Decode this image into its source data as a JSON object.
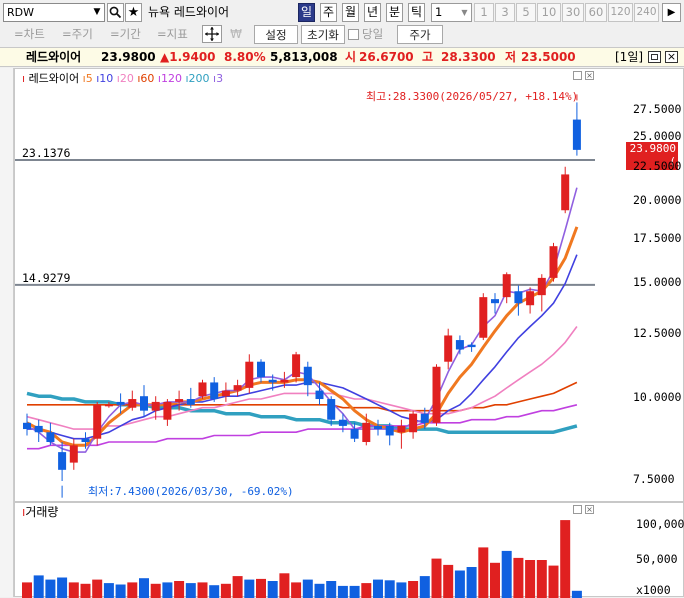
{
  "toolbar": {
    "symbol_input": "RDW",
    "search_icon": "search-icon",
    "star_icon": "star-icon",
    "stock_name": "뉴욕 레드와이어",
    "period_buttons": [
      "일",
      "주",
      "월",
      "년",
      "분",
      "틱"
    ],
    "active_period": "일",
    "interval_value": "1",
    "interval_options": [
      "1",
      "3",
      "5",
      "10",
      "30",
      "60",
      "120",
      "240"
    ],
    "arrow_icon": "arrow-right-icon"
  },
  "toolbar2": {
    "chart_btn": "=차트",
    "period_btn": "=주기",
    "range_btn": "=기간",
    "indicator_btn": "=지표",
    "move_icon": "crosshair-move-icon",
    "won_icon": "won-icon",
    "settings_btn": "설정",
    "reset_btn": "초기화",
    "today_label": "당일",
    "price_btn": "주가"
  },
  "quote": {
    "name": "레드와이어",
    "price": "23.9800",
    "change": "▲1.9400",
    "change_pct": "8.80%",
    "volume": "5,813,008",
    "open_label": "시",
    "open": "26.6700",
    "high_label": "고",
    "high": "28.3300",
    "low_label": "저",
    "low": "23.5000",
    "period_label": "[1일]",
    "colors": {
      "up": "#e02020",
      "down": "#1060e0",
      "high": "#e02020",
      "low": "#1060e0"
    }
  },
  "legend": {
    "title": "레드와이어",
    "items": [
      {
        "label": "5",
        "color": "#f07820"
      },
      {
        "label": "10",
        "color": "#4040e0"
      },
      {
        "label": "20",
        "color": "#f080c0"
      },
      {
        "label": "60",
        "color": "#e04000"
      },
      {
        "label": "120",
        "color": "#c040e0"
      },
      {
        "label": "200",
        "color": "#30a0c0"
      },
      {
        "label": "3",
        "color": "#9060e0"
      }
    ]
  },
  "annotations": {
    "max_label": "최고:28.3300(2026/05/27, +18.14%)",
    "min_label": "최저:7.4300(2026/03/30, -69.02%)",
    "line1_value": "23.1376",
    "line2_value": "14.9279",
    "current_price": "23.9800",
    "current_pct": "( 8.80%)"
  },
  "chart_data": [
    {
      "type": "candlestick",
      "title": "레드와이어",
      "yticks": [
        "27.5000",
        "25.0000",
        "22.5000",
        "20.0000",
        "17.5000",
        "15.0000",
        "12.5000",
        "10.0000",
        "7.5000"
      ],
      "ylim": [
        7.0,
        29.0
      ],
      "candles": [
        {
          "o": 9.2,
          "h": 9.5,
          "l": 8.8,
          "c": 9.0
        },
        {
          "o": 9.1,
          "h": 9.3,
          "l": 8.6,
          "c": 8.9
        },
        {
          "o": 8.9,
          "h": 9.2,
          "l": 8.5,
          "c": 8.6
        },
        {
          "o": 8.3,
          "h": 8.6,
          "l": 7.5,
          "c": 7.8
        },
        {
          "o": 8.0,
          "h": 8.7,
          "l": 7.8,
          "c": 8.5
        },
        {
          "o": 8.7,
          "h": 8.9,
          "l": 8.4,
          "c": 8.6
        },
        {
          "o": 8.7,
          "h": 9.9,
          "l": 8.5,
          "c": 9.8
        },
        {
          "o": 9.8,
          "h": 9.9,
          "l": 9.7,
          "c": 9.8
        },
        {
          "o": 9.9,
          "h": 10.2,
          "l": 9.5,
          "c": 9.8
        },
        {
          "o": 9.7,
          "h": 10.3,
          "l": 9.6,
          "c": 10.0
        },
        {
          "o": 10.1,
          "h": 10.5,
          "l": 9.4,
          "c": 9.6
        },
        {
          "o": 9.6,
          "h": 10.1,
          "l": 9.3,
          "c": 9.9
        },
        {
          "o": 9.3,
          "h": 10.0,
          "l": 9.1,
          "c": 9.9
        },
        {
          "o": 9.9,
          "h": 10.3,
          "l": 9.6,
          "c": 10.0
        },
        {
          "o": 10.0,
          "h": 10.4,
          "l": 9.7,
          "c": 9.8
        },
        {
          "o": 10.1,
          "h": 10.7,
          "l": 10.0,
          "c": 10.6
        },
        {
          "o": 10.6,
          "h": 10.8,
          "l": 9.9,
          "c": 10.0
        },
        {
          "o": 10.1,
          "h": 10.6,
          "l": 9.9,
          "c": 10.3
        },
        {
          "o": 10.3,
          "h": 10.7,
          "l": 10.1,
          "c": 10.5
        },
        {
          "o": 10.4,
          "h": 11.7,
          "l": 10.2,
          "c": 11.4
        },
        {
          "o": 11.4,
          "h": 11.5,
          "l": 10.6,
          "c": 10.8
        },
        {
          "o": 10.7,
          "h": 10.9,
          "l": 10.3,
          "c": 10.6
        },
        {
          "o": 10.6,
          "h": 11.0,
          "l": 10.4,
          "c": 10.7
        },
        {
          "o": 10.8,
          "h": 11.8,
          "l": 10.6,
          "c": 11.7
        },
        {
          "o": 11.2,
          "h": 11.4,
          "l": 10.1,
          "c": 10.5
        },
        {
          "o": 10.3,
          "h": 10.6,
          "l": 9.8,
          "c": 10.0
        },
        {
          "o": 10.0,
          "h": 10.1,
          "l": 9.1,
          "c": 9.3
        },
        {
          "o": 9.3,
          "h": 9.5,
          "l": 8.9,
          "c": 9.1
        },
        {
          "o": 9.0,
          "h": 9.2,
          "l": 8.6,
          "c": 8.7
        },
        {
          "o": 8.6,
          "h": 9.5,
          "l": 8.5,
          "c": 9.2
        },
        {
          "o": 9.1,
          "h": 9.3,
          "l": 8.8,
          "c": 9.0
        },
        {
          "o": 9.1,
          "h": 9.2,
          "l": 8.5,
          "c": 8.8
        },
        {
          "o": 8.9,
          "h": 9.3,
          "l": 8.4,
          "c": 9.1
        },
        {
          "o": 8.9,
          "h": 9.6,
          "l": 8.7,
          "c": 9.5
        },
        {
          "o": 9.5,
          "h": 9.7,
          "l": 9.0,
          "c": 9.2
        },
        {
          "o": 9.2,
          "h": 11.3,
          "l": 9.1,
          "c": 11.2
        },
        {
          "o": 11.4,
          "h": 12.8,
          "l": 11.1,
          "c": 12.5
        },
        {
          "o": 12.3,
          "h": 12.5,
          "l": 11.7,
          "c": 11.9
        },
        {
          "o": 12.1,
          "h": 12.2,
          "l": 11.8,
          "c": 12.0
        },
        {
          "o": 12.4,
          "h": 14.5,
          "l": 12.3,
          "c": 14.3
        },
        {
          "o": 14.2,
          "h": 14.5,
          "l": 13.5,
          "c": 14.0
        },
        {
          "o": 14.3,
          "h": 15.6,
          "l": 14.0,
          "c": 15.5
        },
        {
          "o": 14.6,
          "h": 14.9,
          "l": 13.4,
          "c": 14.0
        },
        {
          "o": 13.9,
          "h": 14.8,
          "l": 13.5,
          "c": 14.6
        },
        {
          "o": 14.4,
          "h": 15.5,
          "l": 13.6,
          "c": 15.3
        },
        {
          "o": 15.3,
          "h": 17.3,
          "l": 15.1,
          "c": 17.1
        },
        {
          "o": 19.4,
          "h": 22.6,
          "l": 19.2,
          "c": 22.0
        },
        {
          "o": 26.67,
          "h": 28.33,
          "l": 23.5,
          "c": 23.98
        }
      ],
      "series": [
        {
          "name": "5",
          "color": "#f07820",
          "values": [
            9.2,
            9.0,
            8.9,
            8.6,
            8.5,
            8.5,
            8.8,
            9.2,
            9.5,
            9.8,
            9.8,
            9.8,
            9.8,
            9.9,
            9.9,
            10.0,
            10.1,
            10.2,
            10.3,
            10.5,
            10.6,
            10.6,
            10.6,
            10.7,
            10.7,
            10.6,
            10.3,
            10.0,
            9.6,
            9.3,
            9.1,
            9.0,
            8.9,
            9.0,
            9.1,
            9.5,
            10.2,
            10.8,
            11.3,
            12.0,
            12.7,
            13.4,
            14.0,
            14.3,
            14.6,
            15.3,
            16.4,
            18.3
          ]
        },
        {
          "name": "10",
          "color": "#4040e0",
          "values": [
            9.0,
            9.0,
            8.9,
            8.8,
            8.7,
            8.7,
            8.8,
            8.9,
            9.1,
            9.3,
            9.4,
            9.6,
            9.7,
            9.8,
            9.9,
            9.9,
            10.0,
            10.1,
            10.1,
            10.2,
            10.3,
            10.4,
            10.5,
            10.5,
            10.6,
            10.6,
            10.5,
            10.4,
            10.2,
            10.0,
            9.8,
            9.6,
            9.4,
            9.3,
            9.2,
            9.3,
            9.6,
            9.8,
            10.2,
            10.7,
            11.2,
            11.8,
            12.4,
            12.9,
            13.4,
            14.0,
            15.0,
            16.6
          ]
        },
        {
          "name": "20",
          "color": "#f080c0",
          "values": [
            9.4,
            9.3,
            9.2,
            9.1,
            9.0,
            9.0,
            9.0,
            9.1,
            9.1,
            9.2,
            9.3,
            9.4,
            9.4,
            9.5,
            9.6,
            9.7,
            9.7,
            9.8,
            9.9,
            10.0,
            10.0,
            10.1,
            10.2,
            10.2,
            10.2,
            10.2,
            10.2,
            10.1,
            10.0,
            10.0,
            9.9,
            9.8,
            9.7,
            9.6,
            9.5,
            9.5,
            9.5,
            9.6,
            9.7,
            9.9,
            10.1,
            10.4,
            10.7,
            11.0,
            11.3,
            11.7,
            12.2,
            12.9
          ]
        },
        {
          "name": "60",
          "color": "#e04000",
          "values": [
            9.8,
            9.8,
            9.8,
            9.8,
            9.8,
            9.8,
            9.8,
            9.8,
            9.8,
            9.8,
            9.8,
            9.8,
            9.8,
            9.8,
            9.8,
            9.8,
            9.8,
            9.8,
            9.8,
            9.8,
            9.8,
            9.8,
            9.8,
            9.8,
            9.8,
            9.8,
            9.8,
            9.7,
            9.7,
            9.7,
            9.7,
            9.6,
            9.6,
            9.6,
            9.6,
            9.6,
            9.6,
            9.6,
            9.7,
            9.7,
            9.8,
            9.8,
            9.9,
            10.0,
            10.1,
            10.2,
            10.4,
            10.6
          ]
        },
        {
          "name": "120",
          "color": "#c040e0",
          "values": [
            8.4,
            8.4,
            8.5,
            8.5,
            8.5,
            8.5,
            8.5,
            8.6,
            8.6,
            8.6,
            8.6,
            8.6,
            8.7,
            8.7,
            8.7,
            8.7,
            8.8,
            8.8,
            8.8,
            8.8,
            8.9,
            8.9,
            8.9,
            8.9,
            9.0,
            9.0,
            9.0,
            9.0,
            9.0,
            9.1,
            9.1,
            9.1,
            9.1,
            9.1,
            9.2,
            9.2,
            9.2,
            9.2,
            9.3,
            9.3,
            9.3,
            9.4,
            9.4,
            9.5,
            9.6,
            9.6,
            9.7,
            9.8
          ]
        },
        {
          "name": "200",
          "color": "#30a0c0",
          "values": [
            10.2,
            10.1,
            10.1,
            10.0,
            10.0,
            9.9,
            9.9,
            9.9,
            9.8,
            9.8,
            9.8,
            9.7,
            9.7,
            9.7,
            9.6,
            9.6,
            9.6,
            9.5,
            9.5,
            9.5,
            9.4,
            9.4,
            9.4,
            9.3,
            9.3,
            9.3,
            9.2,
            9.2,
            9.2,
            9.1,
            9.1,
            9.1,
            9.0,
            9.0,
            9.0,
            9.0,
            8.9,
            8.9,
            8.9,
            8.9,
            8.9,
            8.9,
            8.9,
            8.9,
            8.9,
            8.9,
            9.0,
            9.1
          ]
        },
        {
          "name": "3",
          "color": "#9060e0",
          "values": [
            9.1,
            8.9,
            8.6,
            8.4,
            8.3,
            8.3,
            8.9,
            9.4,
            9.8,
            9.9,
            9.8,
            9.8,
            9.9,
            9.9,
            9.9,
            10.1,
            10.2,
            10.3,
            10.3,
            10.7,
            10.8,
            10.8,
            10.7,
            11.0,
            10.9,
            10.4,
            9.9,
            9.5,
            9.0,
            9.0,
            9.0,
            9.0,
            9.0,
            9.2,
            9.3,
            10.0,
            11.0,
            11.9,
            12.1,
            12.9,
            13.4,
            14.6,
            14.5,
            14.7,
            14.6,
            15.7,
            18.1,
            21.0
          ]
        }
      ]
    },
    {
      "type": "bar",
      "title": "거래량",
      "yticks": [
        "100,000",
        "50,000",
        "x1000"
      ],
      "ylim": [
        0,
        120000
      ],
      "values": [
        18000,
        28000,
        22000,
        25000,
        18000,
        16000,
        22000,
        17000,
        15000,
        18000,
        24000,
        16000,
        18000,
        20000,
        17000,
        18000,
        14000,
        16000,
        27000,
        22000,
        23000,
        20000,
        31000,
        18000,
        22000,
        16000,
        20000,
        13000,
        13000,
        17000,
        22000,
        21000,
        18000,
        20000,
        27000,
        52000,
        43000,
        35000,
        40000,
        68000,
        46000,
        63000,
        53000,
        50000,
        50000,
        42000,
        107000,
        6000
      ],
      "directions": [
        "up",
        "down",
        "down",
        "down",
        "up",
        "up",
        "up",
        "down",
        "down",
        "up",
        "down",
        "up",
        "down",
        "up",
        "down",
        "up",
        "down",
        "up",
        "up",
        "down",
        "up",
        "down",
        "up",
        "up",
        "down",
        "down",
        "down",
        "down",
        "down",
        "up",
        "down",
        "down",
        "down",
        "up",
        "down",
        "up",
        "up",
        "down",
        "down",
        "up",
        "up",
        "down",
        "up",
        "up",
        "up",
        "up",
        "up",
        "down"
      ]
    }
  ]
}
